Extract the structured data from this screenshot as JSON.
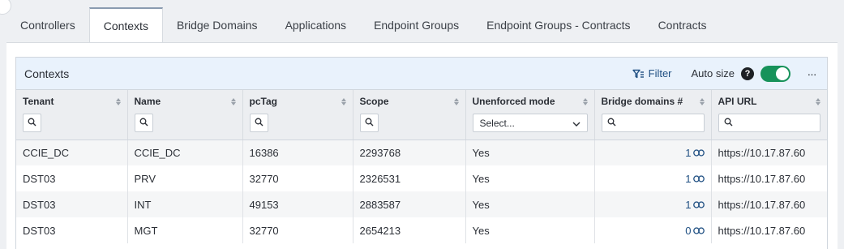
{
  "tabs": [
    {
      "label": "Controllers",
      "active": false
    },
    {
      "label": "Contexts",
      "active": true
    },
    {
      "label": "Bridge Domains",
      "active": false
    },
    {
      "label": "Applications",
      "active": false
    },
    {
      "label": "Endpoint Groups",
      "active": false
    },
    {
      "label": "Endpoint Groups - Contracts",
      "active": false
    },
    {
      "label": "Contracts",
      "active": false
    }
  ],
  "card": {
    "title": "Contexts",
    "filter_label": "Filter",
    "auto_size_label": "Auto size",
    "auto_size_on": true,
    "help_icon": "?",
    "more_icon": "···"
  },
  "columns": [
    {
      "label": "Tenant",
      "filter": "search-button"
    },
    {
      "label": "Name",
      "filter": "search-button"
    },
    {
      "label": "pcTag",
      "filter": "search-button"
    },
    {
      "label": "Scope",
      "filter": "search-button"
    },
    {
      "label": "Unenforced mode",
      "filter": "select",
      "select_value": "Select..."
    },
    {
      "label": "Bridge domains #",
      "filter": "search-input"
    },
    {
      "label": "API URL",
      "filter": "search-input"
    }
  ],
  "rows": [
    {
      "tenant": "CCIE_DC",
      "name": "CCIE_DC",
      "pctag": "16386",
      "scope": "2293768",
      "unenforced": "Yes",
      "bridge_domains": "1",
      "api_url": "https://10.17.87.60"
    },
    {
      "tenant": "DST03",
      "name": "PRV",
      "pctag": "32770",
      "scope": "2326531",
      "unenforced": "Yes",
      "bridge_domains": "1",
      "api_url": "https://10.17.87.60"
    },
    {
      "tenant": "DST03",
      "name": "INT",
      "pctag": "49153",
      "scope": "2883587",
      "unenforced": "Yes",
      "bridge_domains": "1",
      "api_url": "https://10.17.87.60"
    },
    {
      "tenant": "DST03",
      "name": "MGT",
      "pctag": "32770",
      "scope": "2654213",
      "unenforced": "Yes",
      "bridge_domains": "0",
      "api_url": "https://10.17.87.60"
    }
  ],
  "colors": {
    "accent": "#1f4f82",
    "toggle_on": "#17925a",
    "header_bg": "#e9f2fc"
  }
}
